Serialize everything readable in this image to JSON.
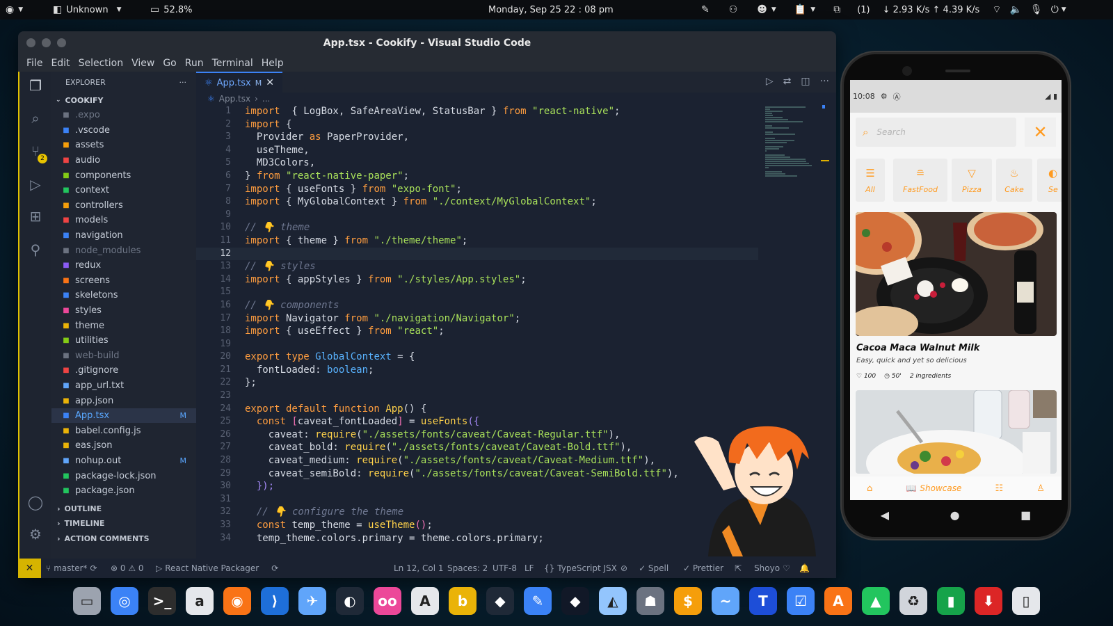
{
  "topbar": {
    "app_name": "Unknown",
    "battery": "52.8%",
    "datetime": "Monday, Sep 25  22 : 08  pm",
    "counter": "(1)",
    "net": "↓ 2.93 K/s ↑ 4.39 K/s"
  },
  "vscode": {
    "title": "App.tsx - Cookify - Visual Studio Code",
    "menu": [
      "File",
      "Edit",
      "Selection",
      "View",
      "Go",
      "Run",
      "Terminal",
      "Help"
    ],
    "scm_badge": "2",
    "explorer": {
      "header": "EXPLORER",
      "more": "···",
      "root": "COOKIFY",
      "items": [
        {
          "name": ".expo",
          "icon": "expo-icon",
          "color": "#6b7280",
          "dim": true,
          "modified": ""
        },
        {
          "name": ".vscode",
          "icon": "vscode-folder-icon",
          "color": "#3b82f6",
          "dim": false,
          "modified": ""
        },
        {
          "name": "assets",
          "icon": "assets-folder-icon",
          "color": "#f59e0b",
          "dim": false,
          "modified": ""
        },
        {
          "name": "audio",
          "icon": "audio-folder-icon",
          "color": "#ef4444",
          "dim": false,
          "modified": ""
        },
        {
          "name": "components",
          "icon": "components-folder-icon",
          "color": "#84cc16",
          "dim": false,
          "modified": ""
        },
        {
          "name": "context",
          "icon": "context-folder-icon",
          "color": "#22c55e",
          "dim": false,
          "modified": ""
        },
        {
          "name": "controllers",
          "icon": "controllers-folder-icon",
          "color": "#f59e0b",
          "dim": false,
          "modified": ""
        },
        {
          "name": "models",
          "icon": "models-folder-icon",
          "color": "#ef4444",
          "dim": false,
          "modified": ""
        },
        {
          "name": "navigation",
          "icon": "navigation-folder-icon",
          "color": "#3b82f6",
          "dim": false,
          "modified": ""
        },
        {
          "name": "node_modules",
          "icon": "node-modules-folder-icon",
          "color": "#6b7280",
          "dim": true,
          "modified": ""
        },
        {
          "name": "redux",
          "icon": "redux-folder-icon",
          "color": "#8b5cf6",
          "dim": false,
          "modified": ""
        },
        {
          "name": "screens",
          "icon": "screens-folder-icon",
          "color": "#f97316",
          "dim": false,
          "modified": ""
        },
        {
          "name": "skeletons",
          "icon": "skeletons-folder-icon",
          "color": "#3b82f6",
          "dim": false,
          "modified": ""
        },
        {
          "name": "styles",
          "icon": "styles-folder-icon",
          "color": "#ec4899",
          "dim": false,
          "modified": ""
        },
        {
          "name": "theme",
          "icon": "theme-folder-icon",
          "color": "#eab308",
          "dim": false,
          "modified": ""
        },
        {
          "name": "utilities",
          "icon": "utilities-folder-icon",
          "color": "#84cc16",
          "dim": false,
          "modified": ""
        },
        {
          "name": "web-build",
          "icon": "web-build-folder-icon",
          "color": "#6b7280",
          "dim": true,
          "modified": ""
        },
        {
          "name": ".gitignore",
          "icon": "git-icon",
          "color": "#ef4444",
          "dim": false,
          "modified": ""
        },
        {
          "name": "app_url.txt",
          "icon": "text-file-icon",
          "color": "#60a5fa",
          "dim": false,
          "modified": ""
        },
        {
          "name": "app.json",
          "icon": "json-icon",
          "color": "#eab308",
          "dim": false,
          "modified": ""
        },
        {
          "name": "App.tsx",
          "icon": "react-icon",
          "color": "#3b82f6",
          "dim": false,
          "modified": "M",
          "active": true
        },
        {
          "name": "babel.config.js",
          "icon": "babel-icon",
          "color": "#eab308",
          "dim": false,
          "modified": ""
        },
        {
          "name": "eas.json",
          "icon": "json-icon",
          "color": "#eab308",
          "dim": false,
          "modified": ""
        },
        {
          "name": "nohup.out",
          "icon": "file-icon",
          "color": "#60a5fa",
          "dim": false,
          "modified": "M"
        },
        {
          "name": "package-lock.json",
          "icon": "npm-icon",
          "color": "#22c55e",
          "dim": false,
          "modified": ""
        },
        {
          "name": "package.json",
          "icon": "npm-icon",
          "color": "#22c55e",
          "dim": false,
          "modified": ""
        }
      ],
      "sections": [
        "OUTLINE",
        "TIMELINE",
        "ACTION COMMENTS"
      ]
    },
    "tab": {
      "name": "App.tsx",
      "mark": "M"
    },
    "breadcrumb": {
      "file": "App.tsx",
      "rest": "..."
    },
    "current_line": 12,
    "code": [
      [
        [
          "kw",
          "import"
        ],
        [
          "",
          "  { LogBox, SafeAreaView, StatusBar } "
        ],
        [
          "kw",
          "from"
        ],
        [
          "",
          " "
        ],
        [
          "st",
          "\"react-native\""
        ],
        [
          "",
          ";"
        ]
      ],
      [
        [
          "kw",
          "import"
        ],
        [
          "",
          " {"
        ]
      ],
      [
        [
          "",
          "  Provider "
        ],
        [
          "kw",
          "as"
        ],
        [
          "",
          " PaperProvider,"
        ]
      ],
      [
        [
          "",
          "  useTheme,"
        ]
      ],
      [
        [
          "",
          "  MD3Colors,"
        ]
      ],
      [
        [
          "",
          "} "
        ],
        [
          "kw",
          "from"
        ],
        [
          "",
          " "
        ],
        [
          "st",
          "\"react-native-paper\""
        ],
        [
          "",
          ";"
        ]
      ],
      [
        [
          "kw",
          "import"
        ],
        [
          "",
          " { useFonts } "
        ],
        [
          "kw",
          "from"
        ],
        [
          "",
          " "
        ],
        [
          "st",
          "\"expo-font\""
        ],
        [
          "",
          ";"
        ]
      ],
      [
        [
          "kw",
          "import"
        ],
        [
          "",
          " { MyGlobalContext } "
        ],
        [
          "kw",
          "from"
        ],
        [
          "",
          " "
        ],
        [
          "st",
          "\"./context/MyGlobalContext\""
        ],
        [
          "",
          ";"
        ]
      ],
      [
        [
          "",
          ""
        ]
      ],
      [
        [
          "cm",
          "// 👇 theme"
        ]
      ],
      [
        [
          "kw",
          "import"
        ],
        [
          "",
          " { theme } "
        ],
        [
          "kw",
          "from"
        ],
        [
          "",
          " "
        ],
        [
          "st",
          "\"./theme/theme\""
        ],
        [
          "",
          ";"
        ]
      ],
      [
        [
          "",
          ""
        ]
      ],
      [
        [
          "cm",
          "// 👇 styles"
        ]
      ],
      [
        [
          "kw",
          "import"
        ],
        [
          "",
          " { appStyles } "
        ],
        [
          "kw",
          "from"
        ],
        [
          "",
          " "
        ],
        [
          "st",
          "\"./styles/App.styles\""
        ],
        [
          "",
          ";"
        ]
      ],
      [
        [
          "",
          ""
        ]
      ],
      [
        [
          "cm",
          "// 👇 components"
        ]
      ],
      [
        [
          "kw",
          "import"
        ],
        [
          "",
          " Navigator "
        ],
        [
          "kw",
          "from"
        ],
        [
          "",
          " "
        ],
        [
          "st",
          "\"./navigation/Navigator\""
        ],
        [
          "",
          ";"
        ]
      ],
      [
        [
          "kw",
          "import"
        ],
        [
          "",
          " { useEffect } "
        ],
        [
          "kw",
          "from"
        ],
        [
          "",
          " "
        ],
        [
          "st",
          "\"react\""
        ],
        [
          "",
          ";"
        ]
      ],
      [
        [
          "",
          ""
        ]
      ],
      [
        [
          "kw",
          "export"
        ],
        [
          "",
          " "
        ],
        [
          "kw",
          "type"
        ],
        [
          "",
          " "
        ],
        [
          "ty",
          "GlobalContext"
        ],
        [
          "",
          " = {"
        ]
      ],
      [
        [
          "",
          "  fontLoaded: "
        ],
        [
          "ty",
          "boolean"
        ],
        [
          "",
          ";"
        ]
      ],
      [
        [
          "",
          "};"
        ]
      ],
      [
        [
          "",
          ""
        ]
      ],
      [
        [
          "kw",
          "export default function"
        ],
        [
          "",
          " "
        ],
        [
          "fn",
          "App"
        ],
        [
          "",
          "() {"
        ]
      ],
      [
        [
          "",
          "  "
        ],
        [
          "kw",
          "const"
        ],
        [
          "",
          " "
        ],
        [
          "pr",
          "["
        ],
        [
          "",
          "caveat_fontLoaded"
        ],
        [
          "pr",
          "]"
        ],
        [
          "",
          " = "
        ],
        [
          "fn",
          "useFonts"
        ],
        [
          "ob",
          "({"
        ]
      ],
      [
        [
          "",
          "    caveat: "
        ],
        [
          "fn",
          "require"
        ],
        [
          "",
          "("
        ],
        [
          "st",
          "\"./assets/fonts/caveat/Caveat-Regular.ttf\""
        ],
        [
          "",
          "),"
        ]
      ],
      [
        [
          "",
          "    caveat_bold: "
        ],
        [
          "fn",
          "require"
        ],
        [
          "",
          "("
        ],
        [
          "st",
          "\"./assets/fonts/caveat/Caveat-Bold.ttf\""
        ],
        [
          "",
          "),"
        ]
      ],
      [
        [
          "",
          "    caveat_medium: "
        ],
        [
          "fn",
          "require"
        ],
        [
          "",
          "("
        ],
        [
          "st",
          "\"./assets/fonts/caveat/Caveat-Medium.ttf\""
        ],
        [
          "",
          "),"
        ]
      ],
      [
        [
          "",
          "    caveat_semiBold: "
        ],
        [
          "fn",
          "require"
        ],
        [
          "",
          "("
        ],
        [
          "st",
          "\"./assets/fonts/caveat/Caveat-SemiBold.ttf\""
        ],
        [
          "",
          "),"
        ]
      ],
      [
        [
          "",
          "  "
        ],
        [
          "ob",
          "});"
        ]
      ],
      [
        [
          "",
          ""
        ]
      ],
      [
        [
          "",
          "  "
        ],
        [
          "cm",
          "// 👇 configure the theme"
        ]
      ],
      [
        [
          "",
          "  "
        ],
        [
          "kw",
          "const"
        ],
        [
          "",
          " temp_theme = "
        ],
        [
          "fn",
          "useTheme"
        ],
        [
          "pr",
          "()"
        ],
        [
          "",
          ";"
        ]
      ],
      [
        [
          "",
          "  temp_theme.colors.primary = theme.colors.primary;"
        ]
      ]
    ],
    "status": {
      "branch": "master*",
      "problems": "⊗ 0 ⚠ 0",
      "packager": "React Native Packager",
      "position": "Ln 12, Col 1",
      "spaces": "Spaces: 2",
      "encoding": "UTF-8",
      "eol": "LF",
      "language": "TypeScript JSX",
      "spell": "✓ Spell",
      "prettier": "✓ Prettier",
      "user": "Shoyo"
    }
  },
  "phone": {
    "time": "10:08",
    "search_placeholder": "Search",
    "categories": [
      "All",
      "FastFood",
      "Pizza",
      "Cake",
      "Se"
    ],
    "recipe": {
      "title": "Cacoa Maca Walnut Milk",
      "subtitle": "Easy, quick and yet so delicious",
      "likes": "100",
      "time": "50'",
      "ingredients": "2 ingredients"
    },
    "nav_showcase": "Showcase"
  },
  "dock": {
    "apps": [
      {
        "name": "files",
        "color": "#9ca3af",
        "glyph": "▭"
      },
      {
        "name": "chromium",
        "color": "#3b82f6",
        "glyph": "◎"
      },
      {
        "name": "terminal",
        "color": "#2d2d2d",
        "glyph": ">_"
      },
      {
        "name": "amazon",
        "color": "#e5e7eb",
        "glyph": "a"
      },
      {
        "name": "firefox",
        "color": "#f97316",
        "glyph": "◉"
      },
      {
        "name": "vscode",
        "color": "#1e6fd9",
        "glyph": "⟩"
      },
      {
        "name": "blue-app",
        "color": "#60a5fa",
        "glyph": "✈"
      },
      {
        "name": "github",
        "color": "#1f2937",
        "glyph": "◐"
      },
      {
        "name": "flickr",
        "color": "#ec4899",
        "glyph": "oo"
      },
      {
        "name": "android-studio",
        "color": "#e5e7eb",
        "glyph": "A"
      },
      {
        "name": "bloop",
        "color": "#eab308",
        "glyph": "b"
      },
      {
        "name": "figma",
        "color": "#1f2937",
        "glyph": "◆"
      },
      {
        "name": "notes-app",
        "color": "#3b82f6",
        "glyph": "✎"
      },
      {
        "name": "dark-app",
        "color": "#111827",
        "glyph": "◆"
      },
      {
        "name": "fox-app",
        "color": "#93c5fd",
        "glyph": "◭"
      },
      {
        "name": "gimp",
        "color": "#6b7280",
        "glyph": "☗"
      },
      {
        "name": "stacer",
        "color": "#f59e0b",
        "glyph": "$"
      },
      {
        "name": "mustache-app",
        "color": "#60a5fa",
        "glyph": "~"
      },
      {
        "name": "t-app",
        "color": "#1d4ed8",
        "glyph": "T"
      },
      {
        "name": "tasks",
        "color": "#3b82f6",
        "glyph": "☑"
      },
      {
        "name": "app-store",
        "color": "#f97316",
        "glyph": "A"
      },
      {
        "name": "rocket-app",
        "color": "#22c55e",
        "glyph": "▲"
      },
      {
        "name": "trash",
        "color": "#d1d5db",
        "glyph": "♻"
      },
      {
        "name": "pipe-app",
        "color": "#16a34a",
        "glyph": "▮"
      },
      {
        "name": "download-app",
        "color": "#dc2626",
        "glyph": "⬇"
      },
      {
        "name": "device-app",
        "color": "#e5e7eb",
        "glyph": "▯"
      }
    ]
  }
}
